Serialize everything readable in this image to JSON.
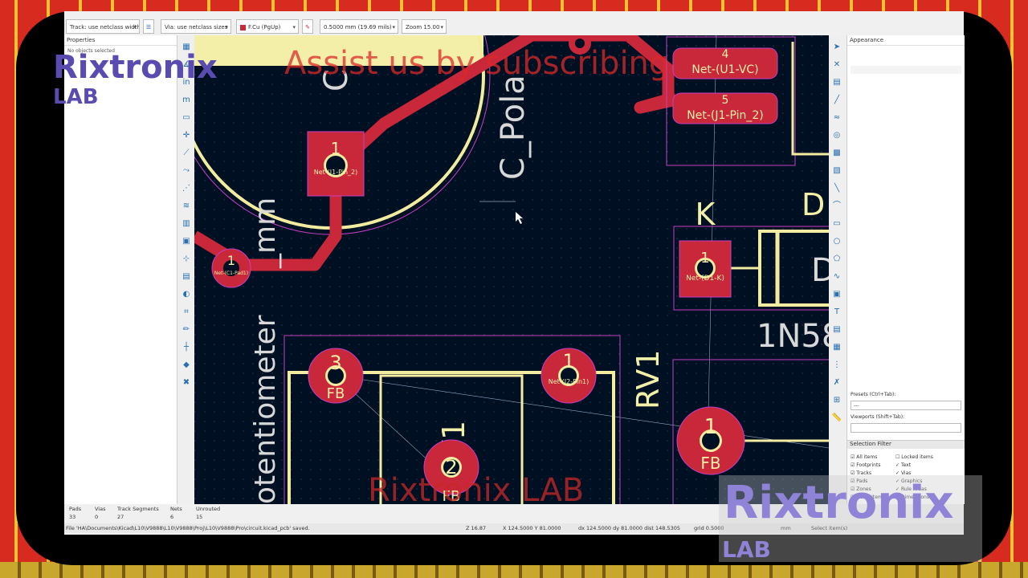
{
  "toolbar": {
    "track_width": "Track: use netclass width",
    "via_size": "Via: use netclass sizes",
    "layer": "F.Cu (PgUp)",
    "grid": "0.5000 mm (19.69 mils)",
    "zoom": "Zoom 15.00"
  },
  "properties": {
    "title": "Properties",
    "empty": "No objects selected"
  },
  "appearance": {
    "title": "Appearance",
    "presets_label": "Presets (Ctrl+Tab):",
    "presets_value": "---",
    "viewports_label": "Viewports (Shift+Tab):",
    "selection_filter_title": "Selection Filter",
    "filter_left": [
      "All items",
      "Footprints",
      "Tracks",
      "Pads",
      "Zones",
      "Other items"
    ],
    "filter_right": [
      "Locked items",
      "Text",
      "Vias",
      "Graphics",
      "Rule Areas",
      "Dimensions"
    ]
  },
  "board": {
    "pads": [
      {
        "num": "1",
        "net": "Net-(J1-Pin_2)"
      },
      {
        "num": "1",
        "net": "Net-(C1-Pad1)"
      },
      {
        "num": "4",
        "net": "Net-(U1-VC)"
      },
      {
        "num": "5",
        "net": "Net-(J1-Pin_2)"
      },
      {
        "num": "1",
        "net": "Net-(D1-K)"
      },
      {
        "num": "3",
        "net": "FB"
      },
      {
        "num": "1",
        "net": "Net-(J2-Pin1)"
      },
      {
        "num": "2",
        "net": "FB"
      },
      {
        "num": "1",
        "net": "FB"
      }
    ],
    "labels": {
      "c_pol": "C_Pola",
      "c_partial": "C",
      "potentiometer": "otentiometer",
      "potentiometer_tail": "_mm",
      "rv1": "RV1",
      "rv1_body": "V1",
      "k": "K",
      "d1_partial": "D",
      "d_partial": "D",
      "diode_part": "1N58"
    }
  },
  "stats": {
    "headers": [
      "Pads",
      "Vias",
      "Track Segments",
      "Nets",
      "Unrouted"
    ],
    "values": [
      "33",
      "0",
      "27",
      "6",
      "15"
    ]
  },
  "statusline": {
    "file": "File 'HA\\Documents\\Kicad\\L10\\V9888\\L10\\V9888\\Proj\\L10\\V9888\\Pro\\circuit.kicad_pcb' saved.",
    "z": "Z 16.87",
    "xy": "X 124.5000  Y 81.0000",
    "dxy": "dx 124.5000  dy 81.0000  dist 148.5305",
    "grid": "grid 0.5000",
    "unit": "mm",
    "select": "Select item(s)"
  },
  "overlays": {
    "brand_top": "Rixtronix",
    "brand_top_sub": "LAB",
    "subscribe": "Assist us by subscribing",
    "watermark": "Rixtronix LAB",
    "brand_bottom": "Rixtronix",
    "brand_bottom_sub": "LAB"
  },
  "colors": {
    "board_bg": "#001023",
    "copper": "#c8283a",
    "silk": "#f2eba0",
    "outline": "#c63fc6"
  }
}
